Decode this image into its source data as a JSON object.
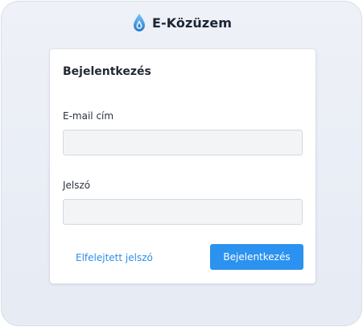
{
  "app": {
    "name": "E-Közüzem",
    "logo_icon": "water-drop-icon"
  },
  "login_card": {
    "title": "Bejelentkezés",
    "email_label": "E-mail cím",
    "email_value": "",
    "email_placeholder": "",
    "password_label": "Jelszó",
    "password_value": "",
    "password_placeholder": "",
    "forgot_password_link": "Elfelejtett jelszó",
    "login_button": "Bejelentkezés"
  },
  "colors": {
    "accent": "#2b92f0",
    "link": "#2f8ee8",
    "background": "#e9edf5",
    "card": "#ffffff",
    "input_background": "#f3f4f6"
  }
}
